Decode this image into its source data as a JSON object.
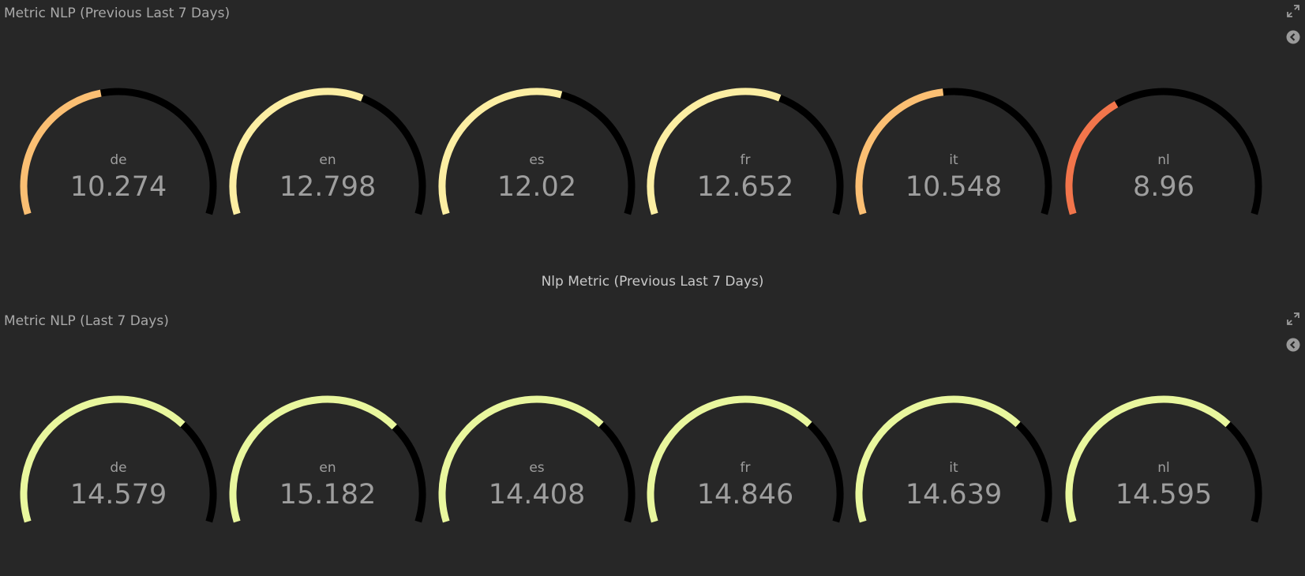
{
  "panels": [
    {
      "title": "Metric NLP (Previous Last 7 Days)",
      "footer": "Nlp Metric (Previous Last 7 Days)",
      "gauges": [
        {
          "label": "de",
          "value": "10.274",
          "fill": 0.45,
          "color": "#FBBF73"
        },
        {
          "label": "en",
          "value": "12.798",
          "fill": 0.6,
          "color": "#FCEEA3"
        },
        {
          "label": "es",
          "value": "12.02",
          "fill": 0.57,
          "color": "#FCEEA3"
        },
        {
          "label": "fr",
          "value": "12.652",
          "fill": 0.6,
          "color": "#FCEEA3"
        },
        {
          "label": "it",
          "value": "10.548",
          "fill": 0.47,
          "color": "#FBBF73"
        },
        {
          "label": "nl",
          "value": "8.96",
          "fill": 0.36,
          "color": "#F2754B"
        }
      ]
    },
    {
      "title": "Metric NLP (Last 7 Days)",
      "gauges": [
        {
          "label": "de",
          "value": "14.579",
          "fill": 0.7,
          "color": "#E9F79E"
        },
        {
          "label": "en",
          "value": "15.182",
          "fill": 0.71,
          "color": "#E9F79E"
        },
        {
          "label": "es",
          "value": "14.408",
          "fill": 0.7,
          "color": "#E9F79E"
        },
        {
          "label": "fr",
          "value": "14.846",
          "fill": 0.7,
          "color": "#E9F79E"
        },
        {
          "label": "it",
          "value": "14.639",
          "fill": 0.7,
          "color": "#E9F79E"
        },
        {
          "label": "nl",
          "value": "14.595",
          "fill": 0.7,
          "color": "#E9F79E"
        }
      ]
    }
  ],
  "icons": {
    "expand": "expand-icon",
    "collapse": "chevron-left-circle-icon"
  },
  "colors": {
    "background": "#272727",
    "track": "#000000",
    "text": "#9e9e9e"
  }
}
